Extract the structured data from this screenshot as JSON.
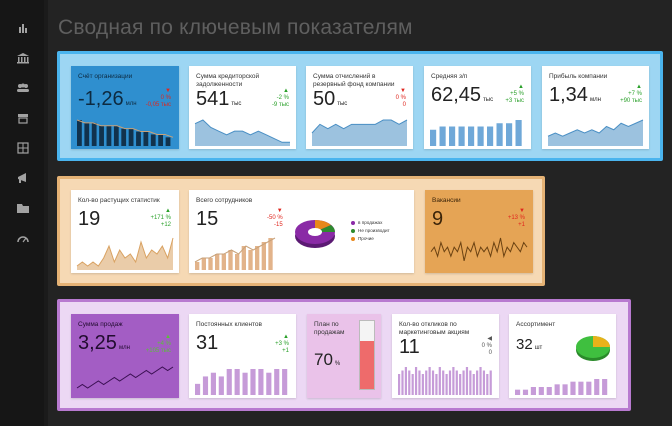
{
  "page": {
    "title": "Сводная по ключевым показателям"
  },
  "sidebar": {
    "items": [
      "chart-icon",
      "bank-icon",
      "people-icon",
      "store-icon",
      "grid-icon",
      "megaphone-icon",
      "folder-icon",
      "dashboard-icon"
    ]
  },
  "groups": {
    "blue": {
      "cards": [
        {
          "label": "Счёт организации",
          "value": "-1,26",
          "unit": "млн",
          "chg1": "0 %",
          "chg2": "-0,05 тыс",
          "dir": "down",
          "series": [
            9,
            8,
            8,
            7,
            7,
            7,
            6,
            6,
            5,
            5,
            4,
            4,
            3
          ]
        },
        {
          "label": "Сумма кредиторской задолженности",
          "value": "541",
          "unit": "тыс",
          "chg1": "-2 %",
          "chg2": "-9 тыс",
          "dir": "up",
          "series": [
            6,
            7,
            5,
            4,
            3,
            4,
            4,
            3,
            4,
            3,
            2,
            1,
            1
          ]
        },
        {
          "label": "Сумма отчислений в резервный фонд компании",
          "value": "50",
          "unit": "тыс",
          "chg1": "0 %",
          "chg2": "0",
          "dir": "down",
          "series": [
            3,
            5,
            4,
            5,
            4,
            5,
            5,
            5,
            5,
            6,
            6,
            5,
            6
          ]
        },
        {
          "label": "Средняя з/п",
          "value": "62,45",
          "unit": "тыс",
          "chg1": "+5 %",
          "chg2": "+3 тыс",
          "dir": "up",
          "series": [
            5,
            6,
            6,
            6,
            6,
            6,
            6,
            7,
            7,
            8
          ]
        },
        {
          "label": "Прибыль компании",
          "value": "1,34",
          "unit": "млн",
          "chg1": "+7 %",
          "chg2": "+90 тыс",
          "dir": "up",
          "series": [
            3,
            4,
            3,
            4,
            5,
            4,
            5,
            4,
            6,
            5,
            7,
            6,
            7,
            8
          ]
        }
      ]
    },
    "orange": {
      "cards": [
        {
          "label": "Кол-во растущих статистик",
          "value": "19",
          "unit": "",
          "chg1": "+171 %",
          "chg2": "+12",
          "dir": "up",
          "series": [
            1,
            2,
            1,
            2,
            1,
            3,
            6,
            2,
            5,
            3,
            4,
            2,
            7,
            3,
            5,
            4,
            6,
            3,
            8
          ]
        },
        {
          "label": "Всего сотрудников",
          "value": "15",
          "unit": "",
          "chg1": "-50 %",
          "chg2": "-15",
          "dir": "down",
          "series": [
            2,
            3,
            3,
            4,
            4,
            5,
            4,
            6,
            5,
            6,
            7,
            8
          ]
        },
        {
          "label": "Вакансии",
          "value": "9",
          "unit": "",
          "chg1": "+13 %",
          "chg2": "+1",
          "dir": "down",
          "series": [
            4,
            5,
            3,
            6,
            4,
            5,
            3,
            5,
            4,
            6,
            2,
            5,
            4,
            6,
            3,
            5,
            4,
            5,
            3,
            6,
            4,
            7,
            3,
            5,
            4,
            6,
            5,
            4,
            6,
            5
          ]
        }
      ],
      "pie_legend": [
        {
          "label": "в продажах",
          "color": "#8a2aa6"
        },
        {
          "label": "Не производит",
          "color": "#2e8b2e"
        },
        {
          "label": "Прочие",
          "color": "#e8871a"
        }
      ]
    },
    "purple": {
      "cards": [
        {
          "label": "Сумма продаж",
          "value": "3,25",
          "unit": "млн",
          "chg1": "+4 %",
          "chg2": "+105 тыс",
          "dir": "up",
          "series": [
            2,
            3,
            2,
            3,
            4,
            3,
            4,
            5,
            4,
            5,
            6,
            5,
            6,
            7,
            6,
            7,
            8,
            7,
            8
          ]
        },
        {
          "label": "Постоянных клиентов",
          "value": "31",
          "unit": "",
          "chg1": "+3 %",
          "chg2": "+1",
          "dir": "up",
          "series": [
            3,
            5,
            6,
            5,
            7,
            7,
            6,
            7,
            7,
            6,
            7,
            7
          ]
        },
        {
          "label": "План по продажам",
          "value": "70",
          "unit": "%",
          "progress": 0.7
        },
        {
          "label": "Кол-во откликов по маркетинговым акциям",
          "value": "11",
          "unit": "",
          "chg1": "0 %",
          "chg2": "0",
          "dir": "neu",
          "series": [
            6,
            7,
            8,
            7,
            6,
            8,
            7,
            6,
            7,
            8,
            7,
            6,
            8,
            7,
            6,
            7,
            8,
            7,
            6,
            7,
            8,
            7,
            6,
            7,
            8,
            7,
            6,
            7
          ]
        },
        {
          "label": "Ассортимент",
          "value": "32",
          "unit": "шт",
          "series": [
            2,
            2,
            3,
            3,
            3,
            4,
            4,
            5,
            5,
            5,
            6,
            6
          ]
        }
      ]
    }
  }
}
